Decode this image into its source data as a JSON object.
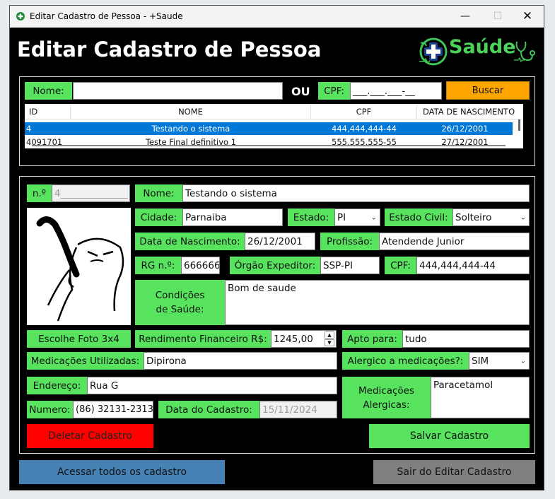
{
  "window": {
    "title": "Editar Cadastro de Pessoa - +Saude"
  },
  "header": {
    "title": "Editar Cadastro de Pessoa",
    "logo_text": "Saúde"
  },
  "search": {
    "nome_label": "Nome:",
    "nome_value": "",
    "ou_label": "OU",
    "cpf_label": "CPF:",
    "cpf_value": "___.___.___-__",
    "buscar_button": "Buscar"
  },
  "results": {
    "columns": [
      "ID",
      "NOME",
      "CPF",
      "DATA DE NASCIMENTO"
    ],
    "rows": [
      {
        "id": "4",
        "nome": "Testando o sistema",
        "cpf": "444,444,444-44",
        "data": "26/12/2001",
        "selected": true
      },
      {
        "id": "4091701",
        "nome": "Teste Final definitivo 1",
        "cpf": "555,555,555-55",
        "data": "27/12/2001",
        "selected": false
      }
    ]
  },
  "form": {
    "numero_label": "n.º",
    "numero_value": "4______________",
    "nome_label": "Nome:",
    "nome_value": "Testando o sistema",
    "cidade_label": "Cidade:",
    "cidade_value": "Parnaiba",
    "estado_label": "Estado:",
    "estado_value": "PI",
    "estado_civil_label": "Estado Civil:",
    "estado_civil_value": "Solteiro",
    "nascimento_label": "Data de Nascimento:",
    "nascimento_value": "26/12/2001",
    "profissao_label": "Profissão:",
    "profissao_value": "Atendende Junior",
    "rg_label": "RG n.º:",
    "rg_value": "666666",
    "orgao_label": "Órgão Expeditor:",
    "orgao_value": "SSP-PI",
    "cpf_label": "CPF:",
    "cpf_value": "444,444,444-44",
    "condicoes_label_1": "Condições",
    "condicoes_label_2": "de Saúde:",
    "condicoes_value": "Bom de saude",
    "foto_button": "Escolhe Foto 3x4",
    "rendimento_label": "Rendimento Financeiro R$:",
    "rendimento_value": "1245,00",
    "apto_label": "Apto para:",
    "apto_value": "tudo",
    "medicacoes_label": "Medicações Utilizadas:",
    "medicacoes_value": "Dipirona",
    "alergico_label": "Alergico a medicações?:",
    "alergico_value": "SIM",
    "endereco_label": "Endereço:",
    "endereco_value": "Rua G",
    "med_alergicas_label_1": "Medicações",
    "med_alergicas_label_2": "Alergicas:",
    "med_alergicas_value": "Paracetamol",
    "numero_tel_label": "Numero:",
    "numero_tel_value": "(86) 32131-2313",
    "data_cadastro_label": "Data do Cadastro:",
    "data_cadastro_value": "15/11/2024",
    "deletar_button": "Deletar Cadastro",
    "salvar_button": "Salvar Cadastro"
  },
  "footer": {
    "acessar_button": "Acessar todos os cadastro",
    "sair_button": "Sair do Editar Cadastro"
  },
  "colors": {
    "accent_green": "#58e35e",
    "buscar_orange": "#ffa500",
    "delete_red": "#ff0000",
    "selection_blue": "#0078d7",
    "acessar_blue": "#4682b4",
    "sair_gray": "#808080"
  }
}
